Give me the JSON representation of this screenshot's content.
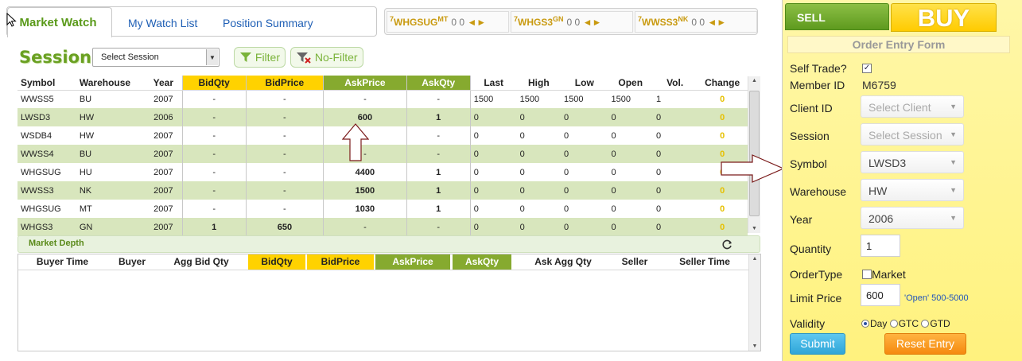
{
  "tabs": [
    {
      "label": "Market Watch"
    },
    {
      "label": "My Watch List"
    },
    {
      "label": "Position Summary"
    }
  ],
  "ticker": [
    {
      "prefix": "7",
      "symbol": "WHGSUG",
      "sup": "MT",
      "vals": "0 0",
      "arrows": "◄►"
    },
    {
      "prefix": "7",
      "symbol": "WHGS3",
      "sup": "GN",
      "vals": "0 0",
      "arrows": "◄►"
    },
    {
      "prefix": "7",
      "symbol": "WWSS3",
      "sup": "NK",
      "vals": "0 0",
      "arrows": "◄►"
    }
  ],
  "session": {
    "label": "Session",
    "select_value": "Select Session",
    "filter_label": "Filter",
    "nofilter_label": "No-Filter"
  },
  "table": {
    "headers": [
      "Symbol",
      "Warehouse",
      "Year",
      "BidQty",
      "BidPrice",
      "AskPrice",
      "AskQty",
      "Last",
      "High",
      "Low",
      "Open",
      "Vol.",
      "Change"
    ],
    "rows": [
      [
        "WWSS5",
        "BU",
        "2007",
        "-",
        "-",
        "-",
        "-",
        "1500",
        "1500",
        "1500",
        "1500",
        "1",
        "0"
      ],
      [
        "LWSD3",
        "HW",
        "2006",
        "-",
        "-",
        "600",
        "1",
        "0",
        "0",
        "0",
        "0",
        "0",
        "0"
      ],
      [
        "WSDB4",
        "HW",
        "2007",
        "-",
        "-",
        "-",
        "-",
        "0",
        "0",
        "0",
        "0",
        "0",
        "0"
      ],
      [
        "WWSS4",
        "BU",
        "2007",
        "-",
        "-",
        "-",
        "-",
        "0",
        "0",
        "0",
        "0",
        "0",
        "0"
      ],
      [
        "WHGSUG",
        "HU",
        "2007",
        "-",
        "-",
        "4400",
        "1",
        "0",
        "0",
        "0",
        "0",
        "0",
        "0"
      ],
      [
        "WWSS3",
        "NK",
        "2007",
        "-",
        "-",
        "1500",
        "1",
        "0",
        "0",
        "0",
        "0",
        "0",
        "0"
      ],
      [
        "WHGSUG",
        "MT",
        "2007",
        "-",
        "-",
        "1030",
        "1",
        "0",
        "0",
        "0",
        "0",
        "0",
        "0"
      ],
      [
        "WHGS3",
        "GN",
        "2007",
        "1",
        "650",
        "-",
        "-",
        "0",
        "0",
        "0",
        "0",
        "0",
        "0"
      ]
    ]
  },
  "depth": {
    "title": "Market Depth",
    "headers": [
      "Buyer Time",
      "Buyer",
      "Agg Bid Qty",
      "BidQty",
      "BidPrice",
      "AskPrice",
      "AskQty",
      "Ask Agg Qty",
      "Seller",
      "Seller Time"
    ]
  },
  "order": {
    "sell_label": "SELL",
    "buy_label": "BUY",
    "title": "Order Entry Form",
    "self_trade_label": "Self Trade?",
    "self_trade_checked": true,
    "member_label": "Member ID",
    "member_id": "M6759",
    "client_label": "Client ID",
    "client_value": "Select Client",
    "session_label": "Session",
    "session_value": "Select Session",
    "symbol_label": "Symbol",
    "symbol_value": "LWSD3",
    "warehouse_label": "Warehouse",
    "warehouse_value": "HW",
    "year_label": "Year",
    "year_value": "2006",
    "quantity_label": "Quantity",
    "quantity_value": "1",
    "ordertype_label": "OrderType",
    "market_label": "Market",
    "limit_label": "Limit Price",
    "limit_value": "600",
    "limit_hint": "'Open' 500-5000",
    "validity_label": "Validity",
    "validity_options": [
      "Day",
      "GTC",
      "GTD"
    ],
    "submit_label": "Submit",
    "reset_label": "Reset Entry"
  },
  "colors": {
    "yellow": "#ffd200",
    "green": "#86aa2f",
    "row_alt": "#d8e6bd",
    "panel": "#fff27e"
  }
}
